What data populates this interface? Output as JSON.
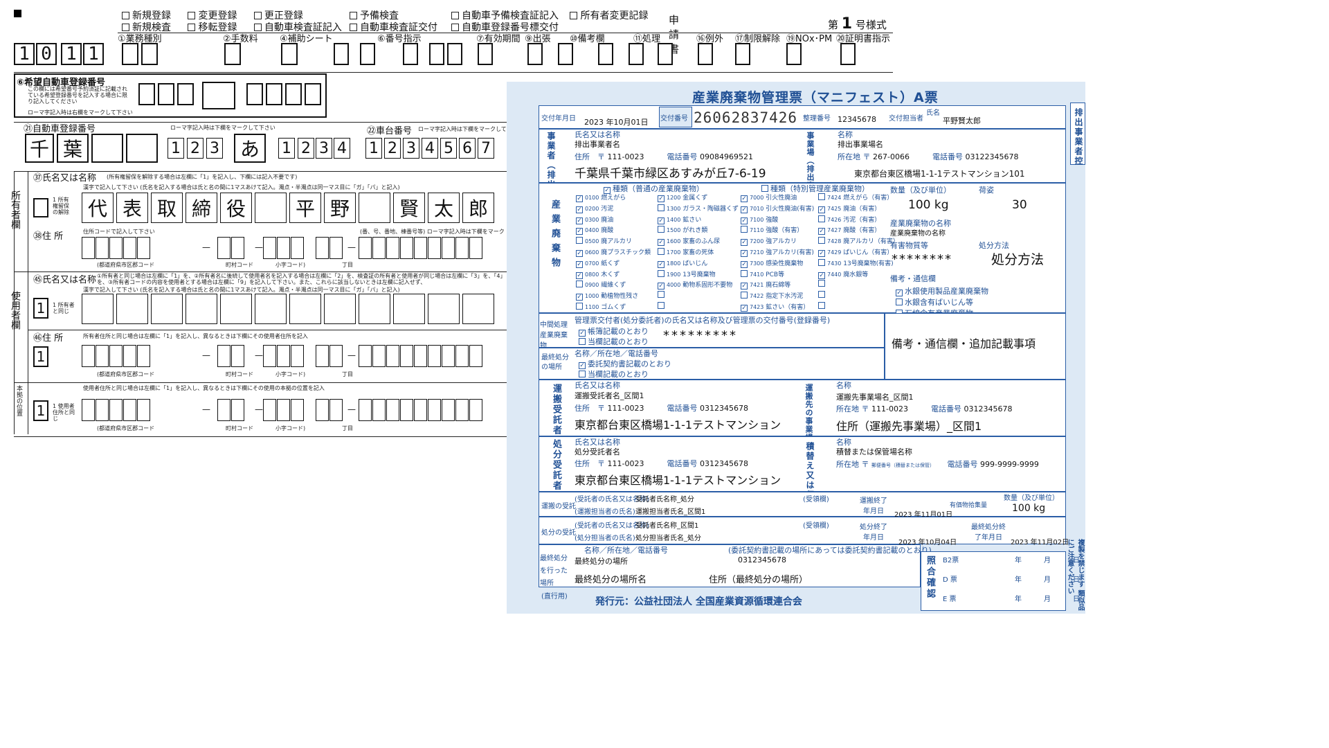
{
  "left_form": {
    "top_checks": [
      [
        "新規登録",
        "変更登録",
        "更正登録"
      ],
      [
        "新規検査",
        "移転登録",
        "自動車検査証記入"
      ]
    ],
    "mid_checks": [
      [
        "予備検査"
      ],
      [
        "自動車検査証交付"
      ]
    ],
    "right_checks": [
      [
        "自動車予備検査証記入",
        "所有者変更記録"
      ],
      [
        "自動車登録番号標交付"
      ]
    ],
    "application": "申請書",
    "form_no_prefix": "第",
    "form_no": "1",
    "form_no_suffix": "号様式",
    "code_digits": [
      "1",
      "0",
      "1",
      "1"
    ],
    "headers": [
      "①業務種別",
      "②手数料",
      "④補助シート",
      "⑥番号指示",
      "⑦有効期間",
      "⑨出張",
      "⑩備考欄",
      "⑪処理",
      "⑯例外",
      "⑰制限解除",
      "⑲NOx･PM",
      "⑳証明書指示"
    ],
    "reg_number_label": "⑥希望自動車登録番号",
    "reg_number_note": "この欄には希望番号予約済証に記載されている希望登録番号を記入する場合に限り記入してください",
    "romaji_note": "ローマ字記入時は右欄をマークして下さい",
    "plate_label": "㉑自動車登録番号",
    "plate_romaji_note": "ローマ字記入時は下欄をマークして下さい",
    "plate_chars": [
      "千",
      "葉",
      "",
      "",
      "1",
      "2",
      "3",
      "あ",
      "1",
      "2",
      "3",
      "4"
    ],
    "chassis_label": "㉒車台番号",
    "chassis_note": "ローマ字記入時は下欄をマークして",
    "chassis_digits": [
      "1",
      "2",
      "3",
      "4",
      "5",
      "6",
      "7"
    ],
    "owner_name_label": "㊲氏名又は名称",
    "owner_name_note": "(所有権留保を解除する場合は左欄に「1」を記入し、下欄には記入不要です)",
    "owner_kanji_note": "漢字で記入して下さい (氏名を記入する場合は氏と名の間に1マスあけて記入。濁点・半濁点は同一マス目に「ガ」「パ」と記入)",
    "owner_chars": [
      "代",
      "表",
      "取",
      "締",
      "役",
      "",
      "平",
      "野",
      "",
      "賢",
      "太",
      "郎"
    ],
    "owner_section": "所有者欄",
    "owner_release_note": "1 所有権留保の解除",
    "owner_addr_label": "㊳住 所",
    "addr_code_note": "住所コードで記入して下さい",
    "addr_tail_note": "(番、号、番地、棟番号等) ローマ字記入時は下欄をマーク",
    "addr_code_labels": [
      "(都道府県市区郡コード",
      "町村コード",
      "小字コード)",
      "丁目"
    ],
    "user_name_label": "㊺氏名又は名称",
    "user_name_note": "①所有者と同じ場合は左欄に「1」を、②所有者名に後続して使用者名を記入する場合は左欄に「2」を、検査証の所有者と使用者が同じ場合は左欄に「3」を、「4」を、③所有者コードの内容を使用者とする場合は左欄に「9」を記入して下さい。また、これらに該当しないときは左欄に記入せず、",
    "user_section": "使用者欄",
    "user_same_note": "1 所有者と同じ",
    "user_addr_label": "㊻住 所",
    "user_addr_note": "所有者住所と同じ場合は左欄に「1」を記入し、異なるときは下欄にその使用者住所を記入",
    "base_section": "本拠の位置",
    "base_note": "使用者住所と同じ場合は左欄に「1」を記入し、異なるときは下欄にその使用の本拠の位置を記入",
    "base_same_note": "1 使用者住所と同じ",
    "one": "1"
  },
  "manifest": {
    "title": "産業廃棄物管理票（マニフェスト）A票",
    "side_label": "排出事業者控",
    "issue_date_label": "交付年月日",
    "issue_year": "2023",
    "issue_month": "10",
    "issue_day": "01",
    "y": "年",
    "m": "月",
    "d": "日",
    "issue_no_label": "交付番号",
    "issue_no": "26062837426",
    "ref_no_label": "整理番号",
    "ref_no": "12345678",
    "person_label": "交付担当者",
    "person_name_label": "氏名",
    "person_name": "平野賢太郎",
    "emitter_label": "事業者（排出者）",
    "name_label": "氏名又は名称",
    "emitter_name": "排出事業者名",
    "addr_label": "住所",
    "postal_mark": "〒",
    "emitter_postal": "111-0023",
    "tel_label": "電話番号",
    "emitter_tel": "09084969521",
    "emitter_address": "千葉県千葉市緑区あすみが丘7-6-19",
    "site_label": "事業場（排出事業場）",
    "site_name_label": "名称",
    "site_name": "排出事業場名",
    "site_loc_label": "所在地",
    "site_postal": "267-0066",
    "site_tel": "03122345678",
    "site_address": "東京都台東区橋場1-1-1テストマンション101",
    "waste_label": "産業廃棄物",
    "waste_type_normal": "種類（普通の産業廃棄物）",
    "waste_type_special": "種類（特別管理産業廃棄物）",
    "waste_col1": [
      {
        "c": "0100",
        "n": "燃えがら",
        "k": true
      },
      {
        "c": "0200",
        "n": "汚泥",
        "k": true
      },
      {
        "c": "0300",
        "n": "廃油",
        "k": true
      },
      {
        "c": "0400",
        "n": "廃酸",
        "k": true
      },
      {
        "c": "0500",
        "n": "廃アルカリ",
        "k": false
      },
      {
        "c": "0600",
        "n": "廃プラスチック類",
        "k": true
      },
      {
        "c": "0700",
        "n": "紙くず",
        "k": true
      },
      {
        "c": "0800",
        "n": "木くず",
        "k": true
      },
      {
        "c": "0900",
        "n": "繊維くず",
        "k": false
      },
      {
        "c": "1000",
        "n": "動植物性残さ",
        "k": true
      },
      {
        "c": "1100",
        "n": "ゴムくず",
        "k": false
      }
    ],
    "waste_col2": [
      {
        "c": "1200",
        "n": "金属くず",
        "k": true
      },
      {
        "c": "1300",
        "n": "ガラス・陶磁器くず",
        "k": false
      },
      {
        "c": "1400",
        "n": "鉱さい",
        "k": true
      },
      {
        "c": "1500",
        "n": "がれき類",
        "k": false
      },
      {
        "c": "1600",
        "n": "家畜のふん尿",
        "k": true
      },
      {
        "c": "1700",
        "n": "家畜の死体",
        "k": false
      },
      {
        "c": "1800",
        "n": "ばいじん",
        "k": true
      },
      {
        "c": "1900",
        "n": "13号廃棄物",
        "k": false
      },
      {
        "c": "4000",
        "n": "動物系固形不要物",
        "k": true
      },
      {
        "c": "",
        "n": "",
        "k": false
      },
      {
        "c": "",
        "n": "",
        "k": false
      }
    ],
    "waste_col3": [
      {
        "c": "7000",
        "n": "引火性廃油",
        "k": true
      },
      {
        "c": "7010",
        "n": "引火性廃油(有害)",
        "k": true
      },
      {
        "c": "7100",
        "n": "強酸",
        "k": true
      },
      {
        "c": "7110",
        "n": "強酸（有害）",
        "k": false
      },
      {
        "c": "7200",
        "n": "強アルカリ",
        "k": true
      },
      {
        "c": "7210",
        "n": "強アルカリ(有害)",
        "k": true
      },
      {
        "c": "7300",
        "n": "感染性廃棄物",
        "k": true
      },
      {
        "c": "7410",
        "n": "PCB等",
        "k": false
      },
      {
        "c": "7421",
        "n": "廃石綿等",
        "k": true
      },
      {
        "c": "7422",
        "n": "指定下水汚泥",
        "k": false
      },
      {
        "c": "7423",
        "n": "鉱さい（有害）",
        "k": true
      }
    ],
    "waste_col4": [
      {
        "c": "7424",
        "n": "燃えがら（有害）",
        "k": false
      },
      {
        "c": "7425",
        "n": "廃油（有害）",
        "k": true
      },
      {
        "c": "7426",
        "n": "汚泥（有害）",
        "k": false
      },
      {
        "c": "7427",
        "n": "廃酸（有害）",
        "k": true
      },
      {
        "c": "7428",
        "n": "廃アルカリ（有害）",
        "k": false
      },
      {
        "c": "7429",
        "n": "ばいじん（有害）",
        "k": true
      },
      {
        "c": "7430",
        "n": "13号廃棄物(有害)",
        "k": false
      },
      {
        "c": "7440",
        "n": "廃水銀等",
        "k": true
      },
      {
        "c": "",
        "n": "",
        "k": false
      },
      {
        "c": "",
        "n": "",
        "k": false
      },
      {
        "c": "",
        "n": "",
        "k": false
      }
    ],
    "qty_label": "数量（及び単位）",
    "qty": "100 kg",
    "pack_label": "荷姿",
    "pack": "30",
    "waste_name_label": "産業廃棄物の名称",
    "waste_name": "産業廃棄物の名称",
    "hazard_label": "有害物質等",
    "hazard": "********",
    "disposal_method_label": "処分方法",
    "disposal_method": "処分方法",
    "remarks_label": "備考・通信欄",
    "remarks_checks": [
      {
        "n": "水銀使用製品産業廃棄物",
        "k": true
      },
      {
        "n": "水銀含有ばいじん等",
        "k": false
      },
      {
        "n": "石綿含有産業廃棄物",
        "k": false
      },
      {
        "n": "特定産業廃棄物",
        "k": false
      }
    ],
    "remarks_text": "備考・通信欄・追加記載事項",
    "intermediate_label": "中間処理産業廃棄物",
    "intermediate_note": "管理票交付者(処分委託者)の氏名又は名称及び管理票の交付番号(登録番号)",
    "intermediate_check1": "帳簿記載のとおり",
    "intermediate_check2": "当欄記載のとおり",
    "intermediate_value": "*********",
    "final_site_label": "最終処分の場所",
    "final_site_note": "名称／所在地／電話番号",
    "final_check1": "委託契約書記載のとおり",
    "final_check2": "当欄記載のとおり",
    "carrier_label": "運搬受託者",
    "carrier_name": "運搬受託者名_区間1",
    "carrier_postal": "111-0023",
    "carrier_tel": "0312345678",
    "carrier_address": "東京都台東区橋場1-1-1テストマンション",
    "dest_label": "運搬先の事業場（処分事業場）",
    "dest_name": "運搬先事業場名_区間1",
    "dest_postal": "111-0023",
    "dest_tel": "0312345678",
    "dest_address": "住所（運搬先事業場）_区間1",
    "disposer_label": "処分受託者",
    "disposer_name": "処分受託者名",
    "disposer_postal": "111-0023",
    "disposer_tel": "0312345678",
    "disposer_address": "東京都台東区橋場1-1-1テストマンション",
    "storage_label": "積替え又は保管",
    "storage_name": "積替または保管場名称",
    "storage_loc_note": "郵便番号（積替または保管）",
    "storage_tel": "999-9999-9999",
    "transport_recv_label": "運搬の受託",
    "dispose_recv_label": "処分の受託",
    "trustee_label": "(受託者の氏名又は名称)",
    "handler_label": "(運搬担当者の氏名)",
    "handler2_label": "(処分担当者の氏名)",
    "transport_trustee": "受託者氏名称_処分",
    "transport_handler": "運搬担当者氏名_区間1",
    "dispose_trustee": "受託者氏名称_区間1",
    "dispose_handler": "処分担当者氏名_処分",
    "seal_label": "(受領欄)",
    "transport_end_label": "運搬終了年月日",
    "transport_end": "2023 年11月01日",
    "valuables_label": "有価物拾集量",
    "qty2_label": "数量（及び単位）",
    "qty2": "100 kg",
    "dispose_end_label": "処分終了年月日",
    "dispose_end": "2023 年10月04日",
    "final_end_label": "最終処分終了年月日",
    "final_end": "2023 年11月02日",
    "final_done_label": "最終処分を行った場所",
    "final_done_note": "名称／所在地／電話番号",
    "contract_note": "(委託契約書記載の場所にあっては委託契約書記載のとおり)",
    "final_place_name": "最終処分の場所",
    "final_place_tel": "0312345678",
    "final_place_name2": "最終処分の場所名",
    "final_place_addr": "住所（最終処分の場所）",
    "direct_label": "(直行用)",
    "confirm_label": "照合確認",
    "confirm_rows": [
      "B2票",
      "D 票",
      "E 票"
    ],
    "ymd": [
      "年",
      "月",
      "日"
    ],
    "publisher": "発行元：公益社団法人 全国産業資源循環連合会",
    "copy_note": "複製を禁じます 類似品にご注意ください"
  }
}
